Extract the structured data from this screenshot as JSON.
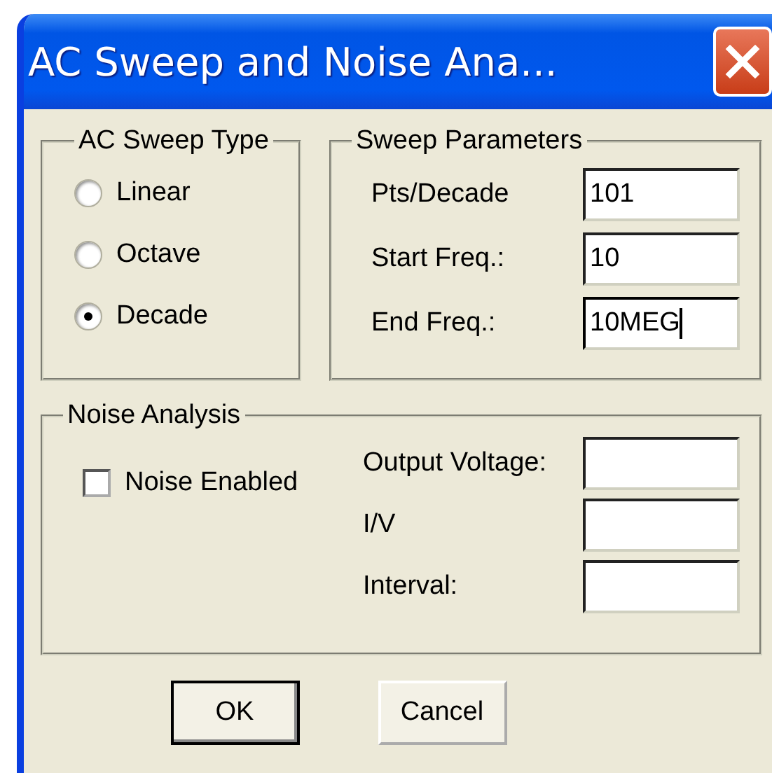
{
  "window": {
    "title": "AC Sweep and Noise Ana..."
  },
  "sweep_type": {
    "title": "AC Sweep Type",
    "options": [
      {
        "label": "Linear",
        "selected": false
      },
      {
        "label": "Octave",
        "selected": false
      },
      {
        "label": "Decade",
        "selected": true
      }
    ]
  },
  "sweep_parameters": {
    "title": "Sweep Parameters",
    "fields": [
      {
        "label": "Pts/Decade",
        "value": "101",
        "focused": false
      },
      {
        "label": "Start Freq.:",
        "value": "10",
        "focused": false
      },
      {
        "label": "End Freq.:",
        "value": "10MEG",
        "focused": true
      }
    ]
  },
  "noise_analysis": {
    "title": "Noise Analysis",
    "checkbox": {
      "label": "Noise Enabled",
      "checked": false
    },
    "fields": [
      {
        "label": "Output Voltage:"
      },
      {
        "label": "I/V"
      },
      {
        "label": "Interval:"
      }
    ]
  },
  "buttons": [
    {
      "label": "OK",
      "default": true
    },
    {
      "label": "Cancel",
      "default": false
    }
  ]
}
